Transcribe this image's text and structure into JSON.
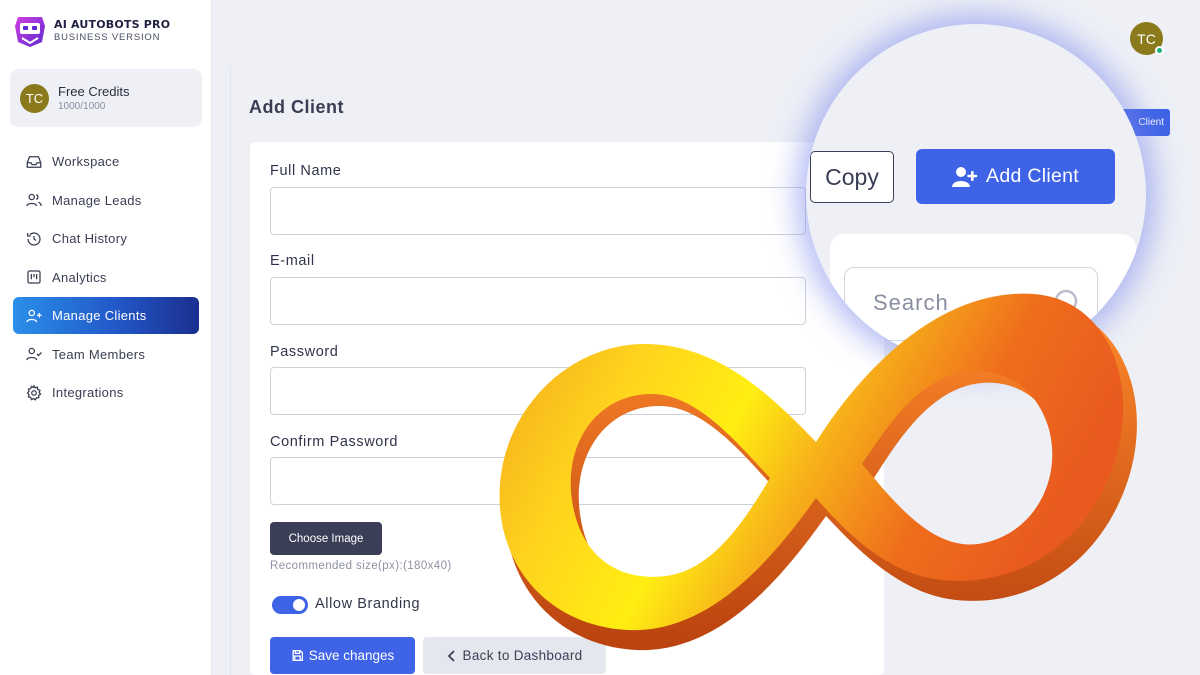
{
  "brand": {
    "name": "AI AUTOBOTS PRO",
    "subtitle": "BUSINESS VERSION"
  },
  "credits": {
    "avatar": "TC",
    "title": "Free Credits",
    "value": "1000/1000"
  },
  "sidebar": {
    "items": [
      {
        "label": "Workspace",
        "icon": "inbox-icon"
      },
      {
        "label": "Manage Leads",
        "icon": "users-icon"
      },
      {
        "label": "Chat History",
        "icon": "history-icon"
      },
      {
        "label": "Analytics",
        "icon": "kanban-icon"
      },
      {
        "label": "Manage Clients",
        "icon": "user-plus-icon",
        "active": true
      },
      {
        "label": "Team Members",
        "icon": "user-check-icon"
      },
      {
        "label": "Integrations",
        "icon": "gear-icon"
      }
    ]
  },
  "topbar": {
    "avatar": "TC"
  },
  "page": {
    "title": "Add Client"
  },
  "header_button": {
    "label": "Client"
  },
  "form": {
    "full_name_label": "Full Name",
    "full_name_value": "",
    "email_label": "E-mail",
    "email_value": "",
    "password_label": "Password",
    "password_value": "",
    "confirm_password_label": "Confirm Password",
    "confirm_password_value": "",
    "choose_image_label": "Choose Image",
    "image_hint": "Recommended size(px):(180x40)",
    "allow_branding_label": "Allow Branding",
    "allow_branding_on": true,
    "save_label": "Save changes",
    "back_label": "Back to Dashboard"
  },
  "magnifier": {
    "copy_label": "Copy",
    "add_client_label": "Add Client",
    "search_placeholder": "Search"
  },
  "colors": {
    "primary": "#3f63e6",
    "sidebar_active_start": "#2a8fe8",
    "sidebar_active_end": "#1a2f8f",
    "avatar": "#8b7a1b",
    "dark_button": "#3b3e57"
  }
}
